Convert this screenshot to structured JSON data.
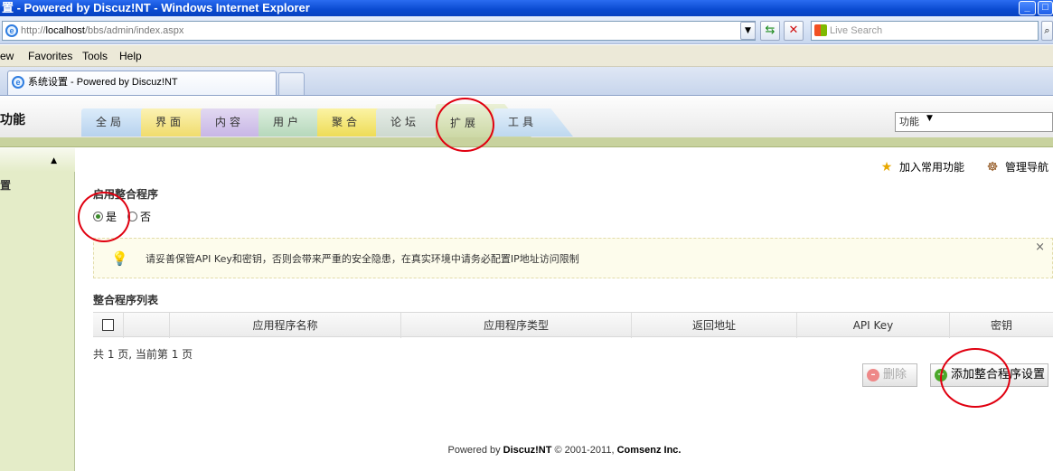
{
  "window": {
    "title": "置 - Powered by Discuz!NT - Windows Internet Explorer"
  },
  "address": {
    "scheme": "http://",
    "host": "localhost",
    "path": "/bbs/admin/index.aspx"
  },
  "search": {
    "placeholder": "Live Search"
  },
  "menu": {
    "items": [
      "ew",
      "Favorites",
      "Tools",
      "Help"
    ]
  },
  "browser_tab": {
    "label": "系统设置 - Powered by Discuz!NT"
  },
  "header": {
    "title": "功能",
    "tabs": [
      "全局",
      "界面",
      "内容",
      "用户",
      "聚合",
      "论坛",
      "扩展",
      "工具"
    ],
    "active_tab": "扩展",
    "function_select": "功能"
  },
  "sidebar": {
    "arrow": "▲",
    "item": "置"
  },
  "quick_links": {
    "add_common": "加入常用功能",
    "nav": "管理导航"
  },
  "form": {
    "title": "启用整合程序",
    "options": [
      "是",
      "否"
    ],
    "selected": "是"
  },
  "notice": {
    "text": "请妥善保管API Key和密钥，否则会带来严重的安全隐患，在真实环境中请务必配置IP地址访问限制",
    "close": "×"
  },
  "list": {
    "title": "整合程序列表",
    "columns": [
      "应用程序名称",
      "应用程序类型",
      "返回地址",
      "API Key",
      "密钥"
    ]
  },
  "pager": {
    "text": "共 1 页, 当前第 1 页"
  },
  "buttons": {
    "delete": "删除",
    "add": "添加整合程序设置"
  },
  "footer": {
    "powered": "Powered by ",
    "brand": "Discuz!NT",
    "copy": " © 2001-2011, ",
    "company": "Comsenz Inc."
  },
  "colors": {
    "titlebar": "#0a4ad0",
    "annotation": "#e00010",
    "sidebar": "#e4ecc8"
  }
}
